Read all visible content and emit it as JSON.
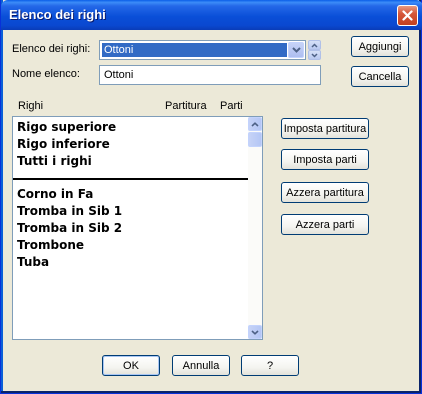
{
  "window": {
    "title": "Elenco dei righi"
  },
  "form": {
    "list_label": "Elenco dei righi:",
    "list_selected": "Ottoni",
    "name_label": "Nome elenco:",
    "name_value": "Ottoni"
  },
  "side_buttons": {
    "add": "Aggiungi",
    "delete": "Cancella"
  },
  "columns": {
    "staves": "Righi",
    "score": "Partitura",
    "parts": "Parti"
  },
  "staves": {
    "special": [
      "Rigo superiore",
      "Rigo inferiore",
      "Tutti i righi"
    ],
    "instruments": [
      "Corno in Fa",
      "Tromba in Sib 1",
      "Tromba in Sib 2",
      "Trombone",
      "Tuba"
    ]
  },
  "actions": {
    "set_score": "Imposta partitura",
    "set_parts": "Imposta parti",
    "reset_score": "Azzera partitura",
    "reset_parts": "Azzera parti"
  },
  "footer": {
    "ok": "OK",
    "cancel": "Annulla",
    "help": "?"
  },
  "colors": {
    "titlebar": "#0a4fd8",
    "selection": "#316ac5",
    "dialog_bg": "#ece9d8",
    "close_button": "#d5573a"
  },
  "icons": [
    "close-icon",
    "combo-arrow-icon",
    "spin-up-icon",
    "spin-down-icon",
    "scroll-up-icon",
    "scroll-down-icon"
  ]
}
